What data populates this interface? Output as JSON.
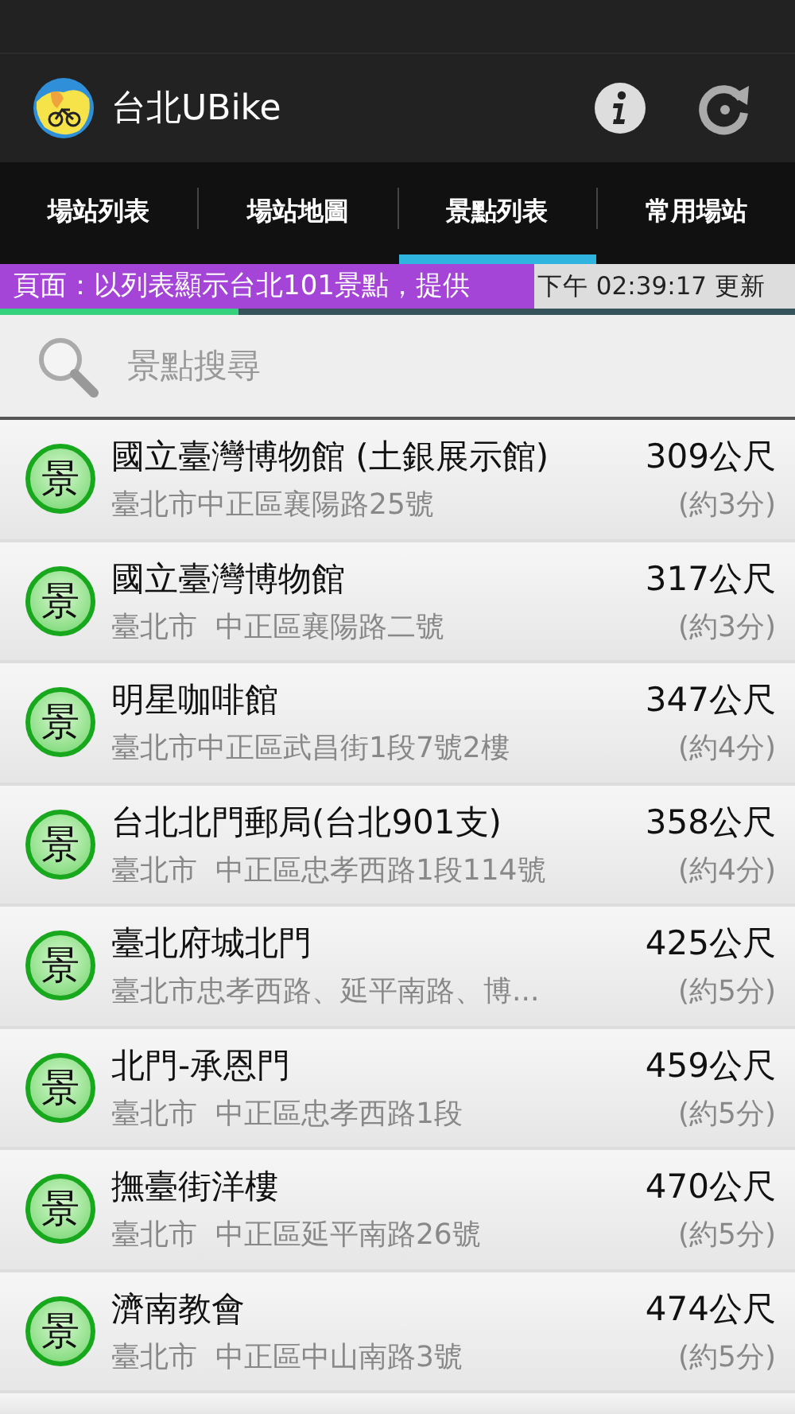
{
  "app_bar": {
    "title": "台北UBike"
  },
  "tabs": [
    {
      "label": "場站列表",
      "selected": false
    },
    {
      "label": "場站地圖",
      "selected": false
    },
    {
      "label": "景點列表",
      "selected": true
    },
    {
      "label": "常用場站",
      "selected": false
    }
  ],
  "ticker": {
    "message": "頁面：以列表顯示台北101景點，提供",
    "update_time": "下午 02:39:17 更新",
    "progress": {
      "level": 0.3
    }
  },
  "search": {
    "placeholder": "景點搜尋"
  },
  "spots": [
    {
      "badge": "景",
      "name": "國立臺灣博物館 (土銀展示館)",
      "address": "臺北市中正區襄陽路25號",
      "distance": "309公尺",
      "walk_time": "(約3分)"
    },
    {
      "badge": "景",
      "name": "國立臺灣博物館",
      "address": "臺北市  中正區襄陽路二號",
      "distance": "317公尺",
      "walk_time": "(約3分)"
    },
    {
      "badge": "景",
      "name": "明星咖啡館",
      "address": "臺北市中正區武昌街1段7號2樓",
      "distance": "347公尺",
      "walk_time": "(約4分)"
    },
    {
      "badge": "景",
      "name": "台北北門郵局(台北901支)",
      "address": "臺北市  中正區忠孝西路1段114號",
      "distance": "358公尺",
      "walk_time": "(約4分)"
    },
    {
      "badge": "景",
      "name": "臺北府城北門",
      "address": "臺北市忠孝西路、延平南路、博...",
      "distance": "425公尺",
      "walk_time": "(約5分)"
    },
    {
      "badge": "景",
      "name": "北門-承恩門",
      "address": "臺北市  中正區忠孝西路1段",
      "distance": "459公尺",
      "walk_time": "(約5分)"
    },
    {
      "badge": "景",
      "name": "撫臺街洋樓",
      "address": "臺北市  中正區延平南路26號",
      "distance": "470公尺",
      "walk_time": "(約5分)"
    },
    {
      "badge": "景",
      "name": "濟南教會",
      "address": "臺北市  中正區中山南路3號",
      "distance": "474公尺",
      "walk_time": "(約5分)"
    }
  ]
}
